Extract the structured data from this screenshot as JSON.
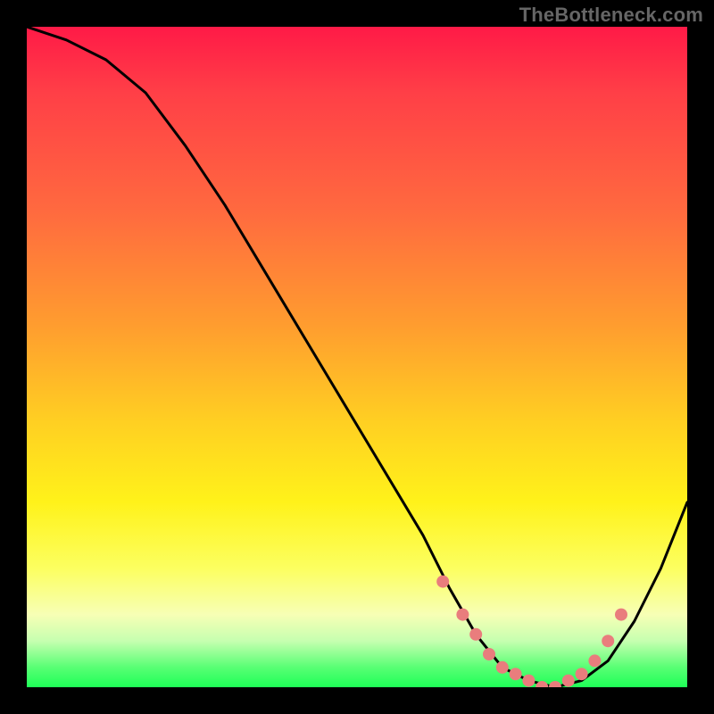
{
  "watermark": "TheBottleneck.com",
  "chart_data": {
    "type": "line",
    "title": "",
    "xlabel": "",
    "ylabel": "",
    "xlim": [
      0,
      100
    ],
    "ylim": [
      0,
      100
    ],
    "series": [
      {
        "name": "bottleneck-curve",
        "x": [
          0,
          6,
          12,
          18,
          24,
          30,
          36,
          42,
          48,
          54,
          60,
          64,
          68,
          72,
          76,
          80,
          84,
          88,
          92,
          96,
          100
        ],
        "y": [
          100,
          98,
          95,
          90,
          82,
          73,
          63,
          53,
          43,
          33,
          23,
          15,
          8,
          3,
          1,
          0,
          1,
          4,
          10,
          18,
          28
        ]
      }
    ],
    "markers": {
      "name": "highlighted-range",
      "x": [
        63,
        66,
        68,
        70,
        72,
        74,
        76,
        78,
        80,
        82,
        84,
        86,
        88,
        90
      ],
      "y": [
        16,
        11,
        8,
        5,
        3,
        2,
        1,
        0,
        0,
        1,
        2,
        4,
        7,
        11
      ],
      "color": "#e97d7d",
      "size": 7
    },
    "gradient_stops": [
      {
        "pos": 0.0,
        "color": "#ff1a47"
      },
      {
        "pos": 0.28,
        "color": "#ff6a3f"
      },
      {
        "pos": 0.6,
        "color": "#ffd022"
      },
      {
        "pos": 0.82,
        "color": "#fcff60"
      },
      {
        "pos": 0.97,
        "color": "#58ff74"
      },
      {
        "pos": 1.0,
        "color": "#1eff57"
      }
    ]
  }
}
